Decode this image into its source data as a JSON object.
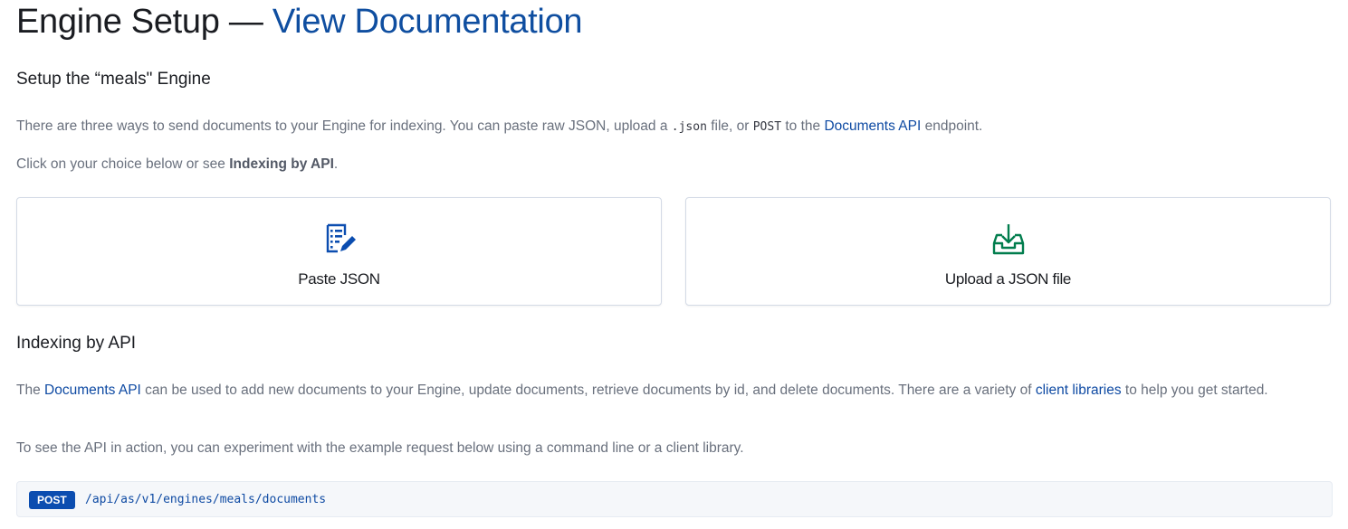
{
  "header": {
    "title_prefix": "Engine Setup — ",
    "docs_link": "View Documentation"
  },
  "setup": {
    "heading": "Setup the “meals\" Engine",
    "intro_1": "There are three ways to send documents to your Engine for indexing. You can paste raw JSON, upload a ",
    "intro_json_code": ".json",
    "intro_2": " file, or ",
    "intro_post_code": "POST",
    "intro_3": " to the ",
    "intro_link": "Documents API",
    "intro_4": " endpoint.",
    "choice_1": "Click on your choice below or see ",
    "choice_bold": "Indexing by API",
    "choice_2": "."
  },
  "cards": [
    {
      "label": "Paste JSON",
      "icon": "document-edit-icon",
      "color": "#0b4db0"
    },
    {
      "label": "Upload a JSON file",
      "icon": "download-tray-icon",
      "color": "#017d4d"
    }
  ],
  "api": {
    "heading": "Indexing by API",
    "p1_a": "The ",
    "p1_link1": "Documents API",
    "p1_b": " can be used to add new documents to your Engine, update documents, retrieve documents by id, and delete documents. There are a variety of ",
    "p1_link2": "client libraries",
    "p1_c": " to help you get started.",
    "p2": "To see the API in action, you can experiment with the example request below using a command line or a client library.",
    "method": "POST",
    "endpoint": "/api/as/v1/engines/meals/documents"
  }
}
